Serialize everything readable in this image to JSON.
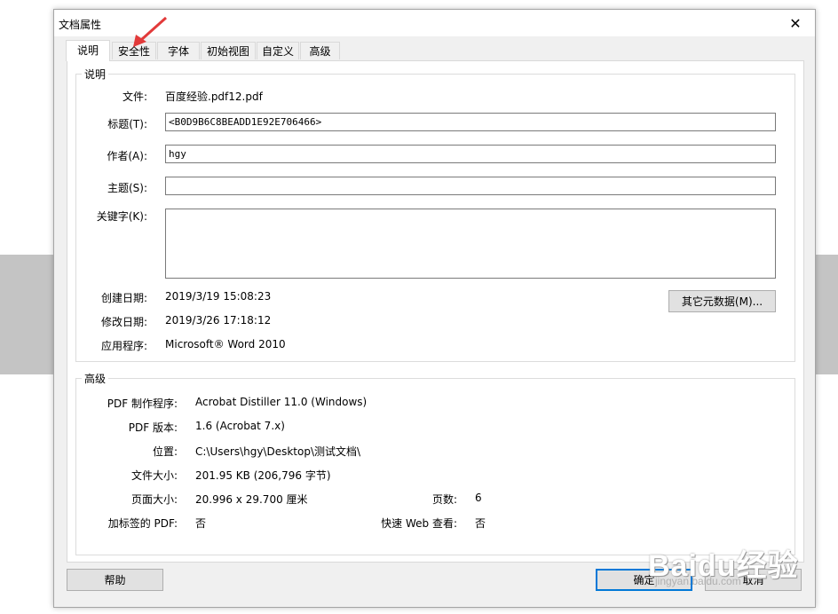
{
  "window": {
    "title": "文档属性",
    "close_glyph": "✕"
  },
  "tabs": [
    {
      "label": "说明",
      "active": true
    },
    {
      "label": "安全性",
      "active": false
    },
    {
      "label": "字体",
      "active": false
    },
    {
      "label": "初始视图",
      "active": false
    },
    {
      "label": "自定义",
      "active": false
    },
    {
      "label": "高级",
      "active": false
    }
  ],
  "description": {
    "legend": "说明",
    "file_label": "文件:",
    "file_value": "百度经验.pdf12.pdf",
    "title_label": "标题(T):",
    "title_value": "<B0D9B6C8BEADD1E92E706466>",
    "author_label": "作者(A):",
    "author_value": "hgy",
    "subject_label": "主题(S):",
    "subject_value": "",
    "keywords_label": "关键字(K):",
    "keywords_value": "",
    "created_label": "创建日期:",
    "created_value": "2019/3/19 15:08:23",
    "modified_label": "修改日期:",
    "modified_value": "2019/3/26 17:18:12",
    "app_label": "应用程序:",
    "app_value": "Microsoft® Word 2010",
    "more_metadata_button": "其它元数据(M)..."
  },
  "advanced": {
    "legend": "高级",
    "producer_label": "PDF 制作程序:",
    "producer_value": "Acrobat Distiller 11.0 (Windows)",
    "version_label": "PDF 版本:",
    "version_value": "1.6 (Acrobat 7.x)",
    "location_label": "位置:",
    "location_value": "C:\\Users\\hgy\\Desktop\\测试文档\\",
    "filesize_label": "文件大小:",
    "filesize_value": "201.95 KB (206,796 字节)",
    "pagesize_label": "页面大小:",
    "pagesize_value": "20.996 x 29.700 厘米",
    "pages_label": "页数:",
    "pages_value": "6",
    "tagged_label": "加标签的 PDF:",
    "tagged_value": "否",
    "fastweb_label": "快速 Web 查看:",
    "fastweb_value": "否"
  },
  "footer": {
    "help": "帮助",
    "ok": "确定",
    "cancel": "取消"
  },
  "watermark": {
    "main": "Baidu经验",
    "sub": "jingyan.baidu.com"
  },
  "colors": {
    "arrow": "#e23a3a",
    "default_button_border": "#0078d7",
    "background_band": "#c4c4c4"
  }
}
